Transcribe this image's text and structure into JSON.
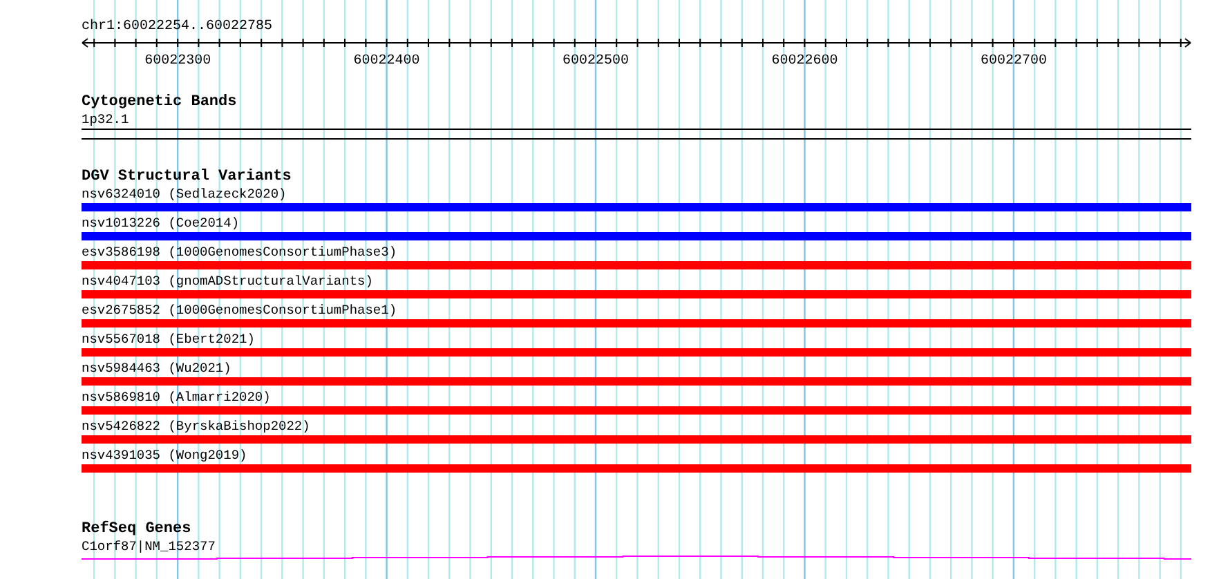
{
  "ruler": {
    "label": "chr1:60022254..60022785",
    "ticks": [
      "60022300",
      "60022400",
      "60022500",
      "60022600",
      "60022700"
    ]
  },
  "tracks": [
    {
      "title": "Cytogenetic Bands",
      "kind": "band",
      "features": [
        {
          "label": "1p32.1"
        }
      ]
    },
    {
      "title": "DGV Structural Variants",
      "kind": "bar",
      "features": [
        {
          "label": "nsv6324010 (Sedlazeck2020)",
          "color": "#0000ff"
        },
        {
          "label": "nsv1013226 (Coe2014)",
          "color": "#0000ff"
        },
        {
          "label": "esv3586198 (1000GenomesConsortiumPhase3)",
          "color": "#ff0000"
        },
        {
          "label": "nsv4047103 (gnomADStructuralVariants)",
          "color": "#ff0000"
        },
        {
          "label": "esv2675852 (1000GenomesConsortiumPhase1)",
          "color": "#ff0000"
        },
        {
          "label": "nsv5567018 (Ebert2021)",
          "color": "#ff0000"
        },
        {
          "label": "nsv5984463 (Wu2021)",
          "color": "#ff0000"
        },
        {
          "label": "nsv5869810 (Almarri2020)",
          "color": "#ff0000"
        },
        {
          "label": "nsv5426822 (ByrskaBishop2022)",
          "color": "#ff0000"
        },
        {
          "label": "nsv4391035 (Wong2019)",
          "color": "#ff0000"
        }
      ]
    },
    {
      "title": "RefSeq Genes",
      "kind": "gene",
      "features": [
        {
          "label": "C1orf87|NM_152377"
        }
      ]
    }
  ]
}
